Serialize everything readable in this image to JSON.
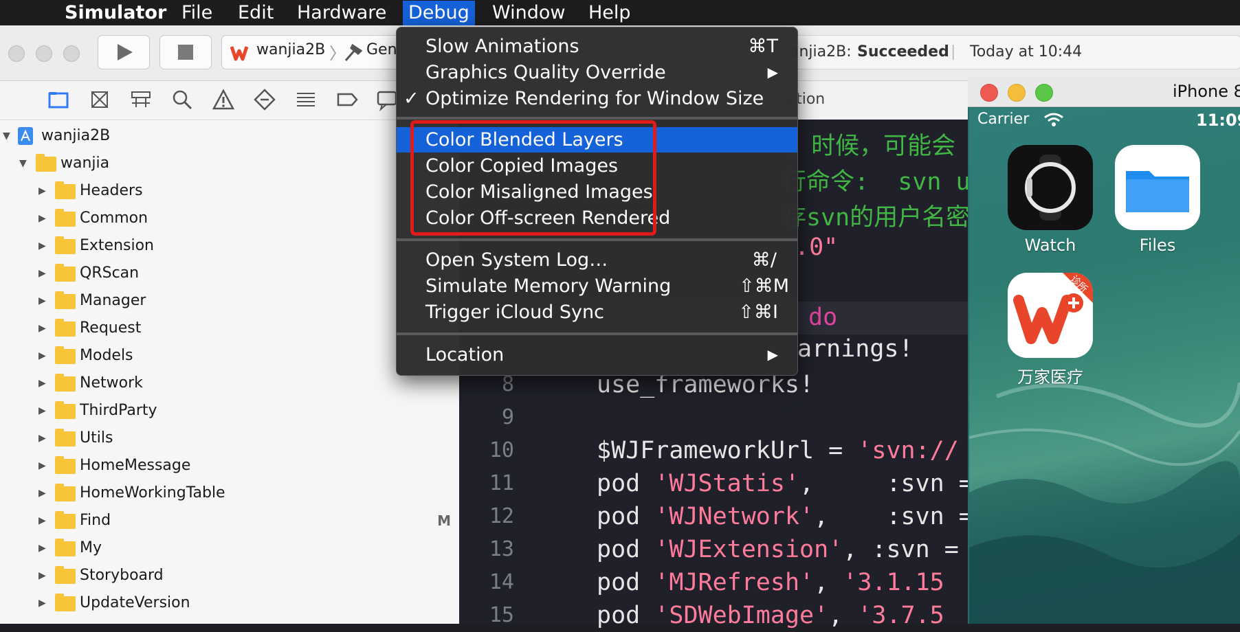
{
  "menubar": {
    "app_name": "Simulator",
    "items": [
      "File",
      "Edit",
      "Hardware",
      "Debug",
      "Window",
      "Help"
    ]
  },
  "toolbar": {
    "scheme_project": "wanjia2B",
    "scheme_target_partial": "Gen",
    "status_project_partial": "anjia2B:",
    "status_result": "Succeeded",
    "status_time": "Today at 10:44"
  },
  "jump_bar": {
    "text_partial": "ction"
  },
  "navigator": {
    "root": "wanjia2B",
    "group": "wanjia",
    "folders": [
      "Headers",
      "Common",
      "Extension",
      "QRScan",
      "Manager",
      "Request",
      "Models",
      "Network",
      "ThirdParty",
      "Utils",
      "HomeMessage",
      "HomeWorkingTable",
      "Find",
      "My",
      "Storyboard",
      "UpdateVersion"
    ],
    "modified_badge": "M"
  },
  "editor": {
    "partial_lines": [
      {
        "text": "l 时候，可能会",
        "kind": "comment"
      },
      {
        "text": "行命令:  svn u",
        "kind": "comment"
      },
      {
        "text": "存svn的用户名密",
        "kind": "comment"
      },
      {
        "text": ".0\"",
        "kind": "string"
      },
      {
        "text": "do",
        "kind": "keyword"
      },
      {
        "text": "arnings!",
        "kind": "plain"
      }
    ],
    "lines": [
      {
        "num": "8",
        "code": "use_frameworks!"
      },
      {
        "num": "9",
        "code": ""
      },
      {
        "num": "10",
        "code": "$WJFrameworkUrl = ",
        "str": "'svn://"
      },
      {
        "num": "11",
        "code": "pod ",
        "str": "'WJStatis'",
        "rest": ",     :svn ="
      },
      {
        "num": "12",
        "code": "pod ",
        "str": "'WJNetwork'",
        "rest": ",    :svn ="
      },
      {
        "num": "13",
        "code": "pod ",
        "str": "'WJExtension'",
        "rest": ", :svn ="
      },
      {
        "num": "14",
        "code": "pod ",
        "str": "'MJRefresh'",
        "rest": ", ",
        "str2": "'3.1.15"
      },
      {
        "num": "15",
        "code": "pod ",
        "str": "'SDWebImage'",
        "rest": ", ",
        "str2": "'3.7.5"
      }
    ]
  },
  "debug_menu": {
    "items": [
      {
        "label": "Slow Animations",
        "shortcut": "⌘T"
      },
      {
        "label": "Graphics Quality Override",
        "shortcut": "▶"
      },
      {
        "label": "Optimize Rendering for Window Size",
        "checked": "✓"
      },
      {
        "label": "Color Blended Layers",
        "selected": true
      },
      {
        "label": "Color Copied Images"
      },
      {
        "label": "Color Misaligned Images"
      },
      {
        "label": "Color Off-screen Rendered"
      },
      {
        "label": "Open System Log…",
        "shortcut": "⌘/"
      },
      {
        "label": "Simulate Memory Warning",
        "shortcut": "⇧⌘M"
      },
      {
        "label": "Trigger iCloud Sync",
        "shortcut": "⇧⌘I"
      },
      {
        "label": "Location",
        "shortcut": "▶"
      }
    ]
  },
  "simulator": {
    "title_partial": "iPhone 8",
    "carrier": "Carrier",
    "time_partial": "11:09",
    "apps": [
      {
        "label": "Watch"
      },
      {
        "label": "Files"
      },
      {
        "label": "万家医疗",
        "badge": "诊所"
      }
    ]
  },
  "colors": {
    "menu_highlight": "#1561d8",
    "annotation_red": "#e01b1b",
    "folder_yellow": "#f7c43a",
    "string_pink": "#ff7b9c",
    "comment_green": "#41b645",
    "keyword_magenta": "#e0449f"
  }
}
